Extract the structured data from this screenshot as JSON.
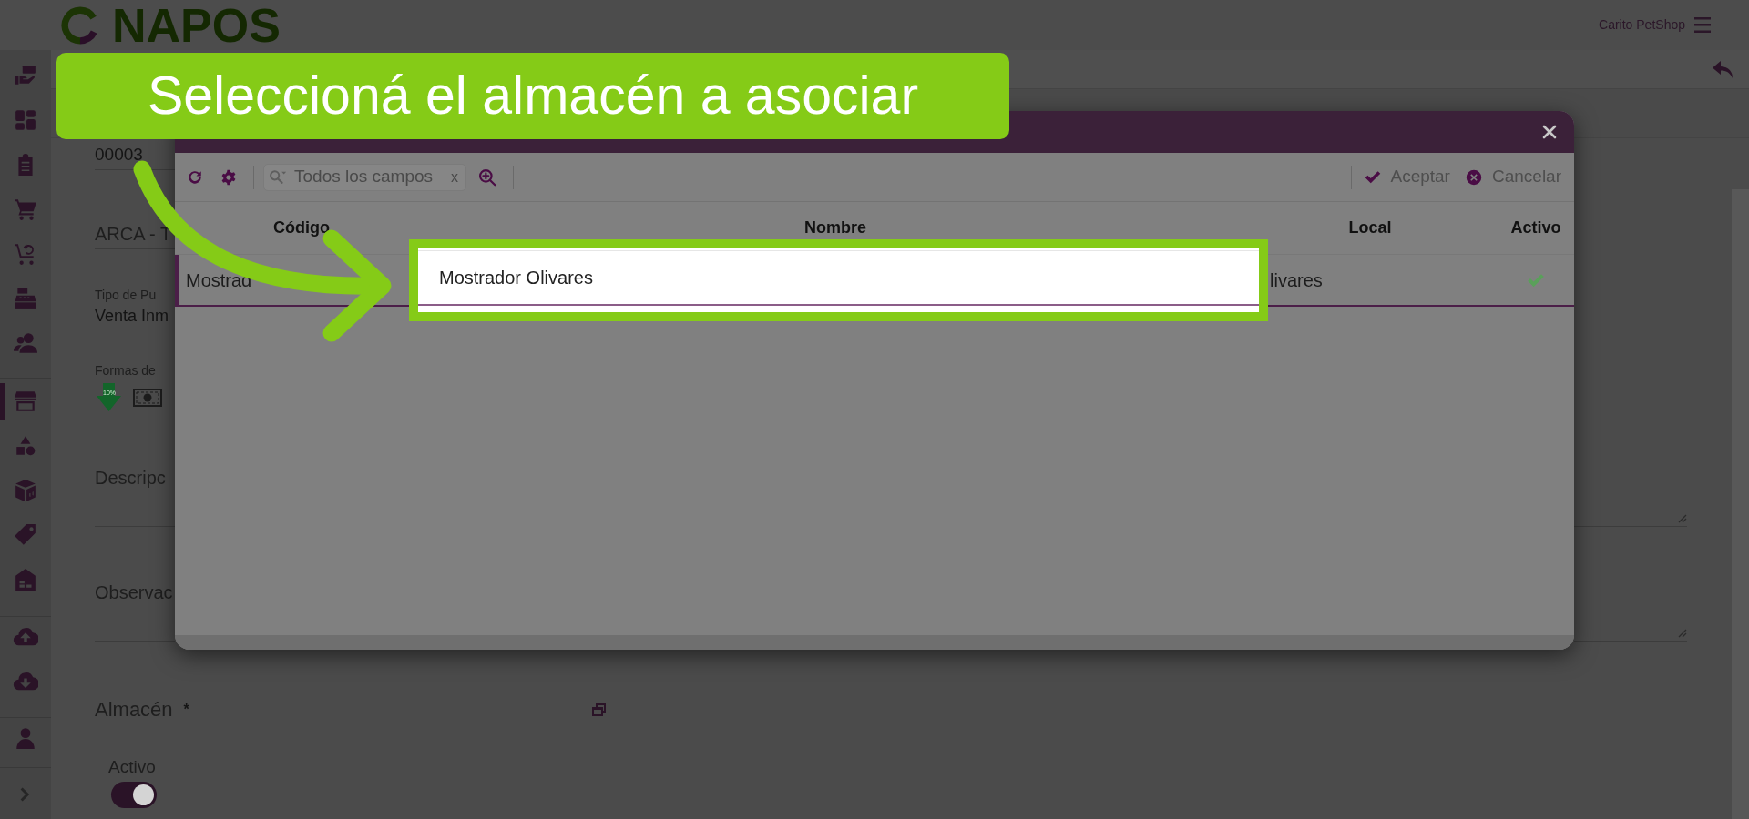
{
  "header": {
    "logo_text": "NAPOS",
    "store_name": "Carito PetShop"
  },
  "sidebar": {
    "groups": [
      {
        "items": [
          {
            "selected": false
          },
          {
            "selected": false
          },
          {
            "selected": false
          },
          {
            "selected": false
          },
          {
            "selected": false
          },
          {
            "selected": false
          },
          {
            "selected": false
          }
        ]
      },
      {
        "items": [
          {
            "selected": true
          },
          {
            "selected": false
          },
          {
            "selected": false
          },
          {
            "selected": false
          },
          {
            "selected": false
          }
        ]
      },
      {
        "items": [
          {
            "selected": false
          },
          {
            "selected": false
          }
        ]
      },
      {
        "items": [
          {
            "selected": false
          }
        ]
      },
      {
        "items": [
          {
            "selected": false
          }
        ]
      }
    ]
  },
  "form": {
    "number": "00003",
    "heading": "ARCA - T",
    "point_type": {
      "label": "Tipo de Pu",
      "value": "Venta Inm"
    },
    "payment_methods": {
      "label": "Formas de",
      "discount_badge": "10%"
    },
    "description": {
      "label": "Descripc"
    },
    "observations": {
      "label": "Observac"
    },
    "warehouse": {
      "label": "Almacén",
      "required_mark": "*"
    },
    "active": {
      "label": "Activo",
      "on": true
    }
  },
  "dialog": {
    "toolbar": {
      "search": {
        "placeholder": "Todos los campos",
        "clear": "x"
      },
      "accept": "Aceptar",
      "cancel": "Cancelar"
    },
    "table": {
      "columns": [
        "Código",
        "Nombre",
        "Local",
        "Activo"
      ],
      "rows": [
        {
          "selected": true,
          "cells": [
            "Mostrad",
            "Mostrador Olivares",
            "livares"
          ],
          "active": true
        }
      ]
    }
  },
  "tutorial": {
    "callout": "Seleccioná el almacén a asociar"
  }
}
